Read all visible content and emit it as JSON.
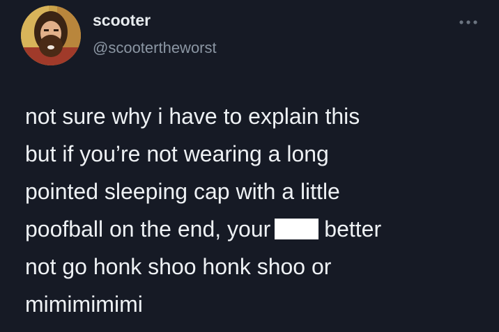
{
  "user": {
    "display_name": "scooter",
    "handle": "@scootertheworst",
    "avatar_icon": "avatar-photo"
  },
  "menu": {
    "icon": "more-options-icon"
  },
  "tweet": {
    "lines": [
      "not sure why i have to explain this",
      "but if you’re not wearing a long",
      "pointed sleeping cap with a little",
      "poofball on the end, your",
      "better",
      "not go honk shoo honk shoo or",
      "mimimimimi"
    ],
    "redacted_word_color": "#ffffff"
  },
  "colors": {
    "background": "#161a25",
    "text": "#e8ecef",
    "muted": "#8b96a3"
  }
}
